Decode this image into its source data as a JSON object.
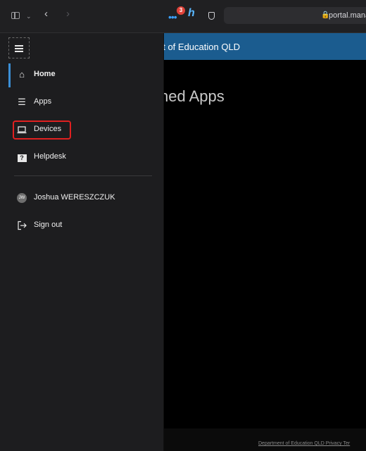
{
  "browser": {
    "url": "portal.mana",
    "extension_badge": "3"
  },
  "page": {
    "header_title": "nt of Education QLD",
    "heading": "shed Apps",
    "footer": "Department of Education QLD Privacy Ter"
  },
  "drawer": {
    "items": [
      {
        "label": "Home",
        "icon": "home-icon"
      },
      {
        "label": "Apps",
        "icon": "apps-list-icon"
      },
      {
        "label": "Devices",
        "icon": "laptop-icon"
      },
      {
        "label": "Helpdesk",
        "icon": "help-icon"
      }
    ],
    "user": {
      "name": "Joshua WERESZCZUK",
      "initials": "JW"
    },
    "sign_out": "Sign out"
  },
  "colors": {
    "header": "#1b5c8f",
    "active_bar": "#3b8fd6",
    "highlight": "#e02020"
  }
}
